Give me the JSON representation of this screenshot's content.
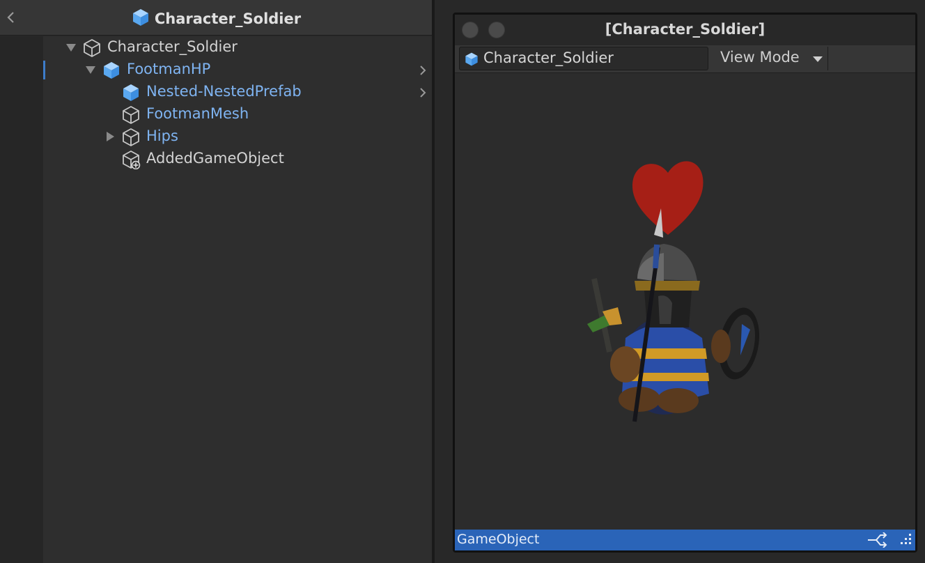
{
  "hierarchy": {
    "header_title": "Character_Soldier",
    "rows": [
      {
        "label": "Character_Soldier",
        "style": "plain",
        "icon": "gameobject-icon",
        "expanded": true
      },
      {
        "label": "FootmanHP",
        "style": "blue",
        "icon": "prefab-icon",
        "expanded": true,
        "has_chevron": true,
        "selected": true
      },
      {
        "label": "Nested-NestedPrefab",
        "style": "blue",
        "icon": "prefab-icon",
        "has_chevron": true
      },
      {
        "label": "FootmanMesh",
        "style": "blue",
        "icon": "gameobject-icon"
      },
      {
        "label": "Hips",
        "style": "blue",
        "icon": "gameobject-icon",
        "expanded": false
      },
      {
        "label": "AddedGameObject",
        "style": "plain",
        "icon": "added-gameobject-icon"
      }
    ]
  },
  "preview": {
    "window_title": "[Character_Soldier]",
    "object_field": "Character_Soldier",
    "view_mode_label": "View Mode",
    "status_label": "GameObject"
  },
  "colors": {
    "prefab_blue": "#7fb4f2",
    "selection_accent": "#3d7cc9",
    "status_bar": "#2a64b8"
  }
}
